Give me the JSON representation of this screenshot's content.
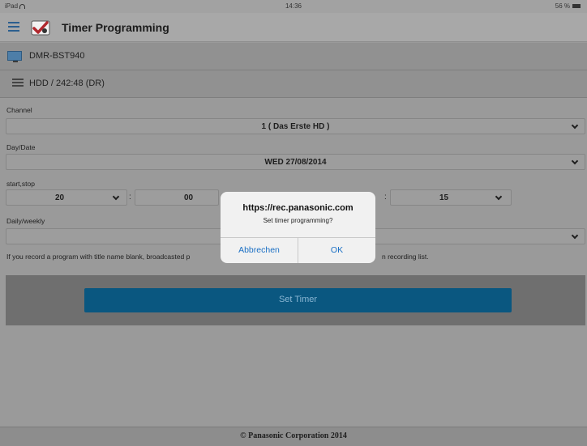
{
  "statusbar": {
    "carrier": "iPad",
    "time": "14:36",
    "battery": "56 %"
  },
  "header": {
    "title": "Timer Programming",
    "menu_icon": "hamburger-icon",
    "app_icon": "timer-check-icon"
  },
  "device": {
    "name": "DMR-BST940",
    "icon": "tv-icon"
  },
  "storage": {
    "text": "HDD / 242:48 (DR)",
    "icon": "hdd-icon"
  },
  "form": {
    "channel_label": "Channel",
    "channel_value": "1 ( Das Erste HD )",
    "date_label": "Day/Date",
    "date_value": "WED 27/08/2014",
    "startstop_label": "start,stop",
    "start_hour": "20",
    "start_min": "00",
    "stop_min": "15",
    "colon": ":",
    "repeat_label": "Daily/weekly",
    "repeat_value": ""
  },
  "note": {
    "part1": "If you record a program with title name blank, broadcasted p",
    "part2": "n recording list."
  },
  "set_timer_label": "Set Timer",
  "footer": "© Panasonic Corporation 2014",
  "dialog": {
    "title": "https://rec.panasonic.com",
    "message": "Set timer programming?",
    "cancel_label": "Abbrechen",
    "ok_label": "OK"
  },
  "colors": {
    "accent": "#0a5780",
    "dialog_link": "#1a6fc4"
  }
}
